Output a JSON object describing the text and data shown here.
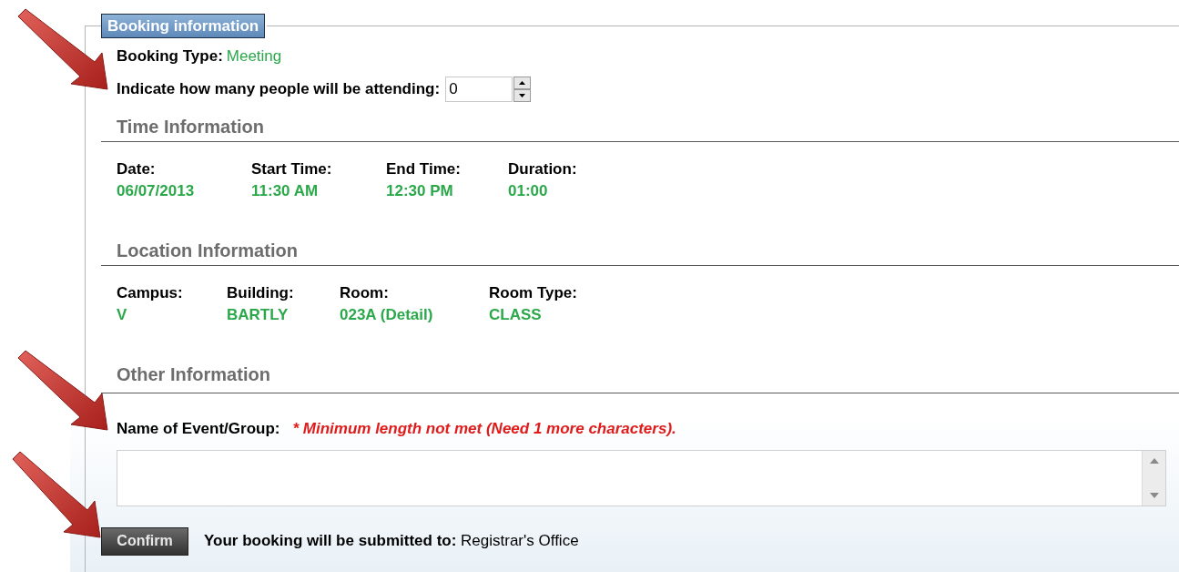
{
  "legend": "Booking information",
  "booking_type": {
    "label": "Booking Type:",
    "value": "Meeting"
  },
  "attendance": {
    "label": "Indicate how many people will be attending:",
    "value": "0"
  },
  "sections": [
    {
      "title": "Time Information",
      "fields": [
        {
          "label": "Date:",
          "value": "06/07/2013"
        },
        {
          "label": "Start Time:",
          "value": "11:30 AM"
        },
        {
          "label": "End Time:",
          "value": "12:30 PM"
        },
        {
          "label": "Duration:",
          "value": "01:00"
        }
      ]
    },
    {
      "title": "Location Information",
      "fields": [
        {
          "label": "Campus:",
          "value": "V"
        },
        {
          "label": "Building:",
          "value": "BARTLY"
        },
        {
          "label": "Room:",
          "value": "023A (Detail)"
        },
        {
          "label": "Room Type:",
          "value": "CLASS"
        }
      ]
    }
  ],
  "other": {
    "title": "Other Information",
    "event_label": "Name of Event/Group:",
    "error": "* Minimum length not met (Need 1 more characters)."
  },
  "confirm": "Confirm",
  "submitted": {
    "label": "Your booking will be submitted to:",
    "value": "Registrar's Office"
  }
}
